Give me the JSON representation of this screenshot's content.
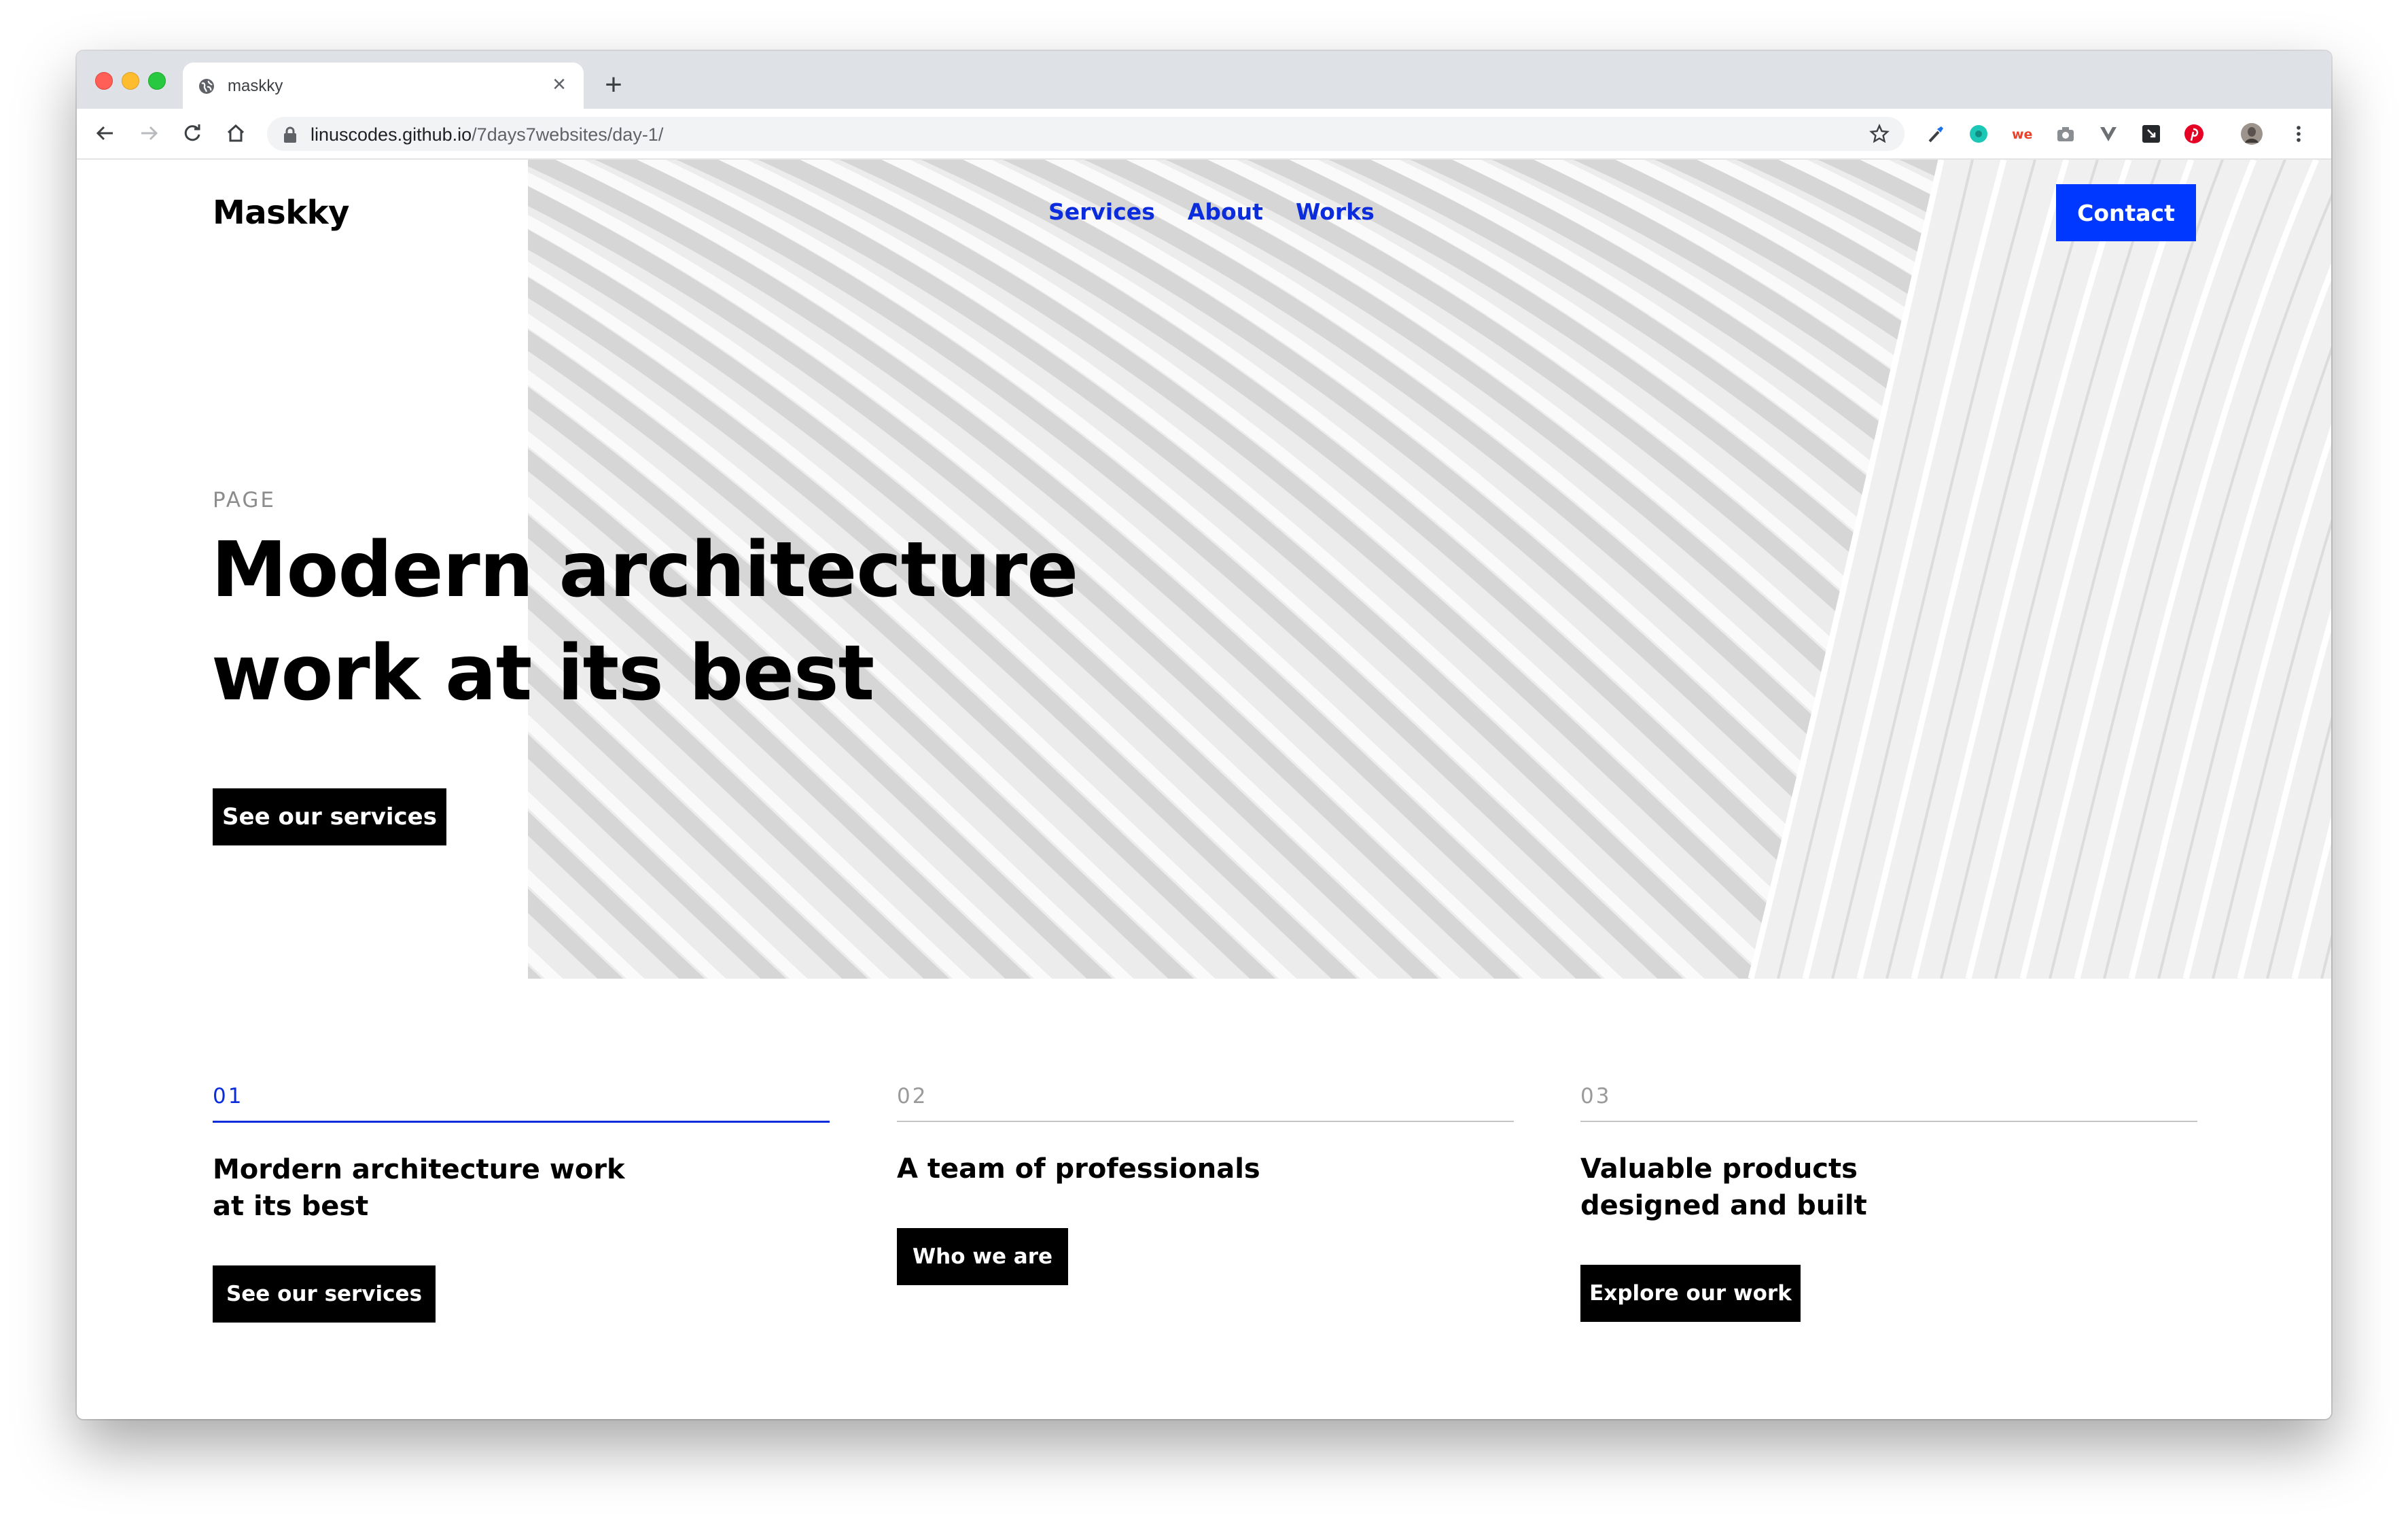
{
  "browser": {
    "tab_title": "maskky",
    "new_tab_label": "+",
    "close_label": "×",
    "url_host": "linuscodes.github.io",
    "url_path": "/7days7websites/day-1/"
  },
  "site": {
    "logo": "Maskky",
    "nav": [
      "Services",
      "About",
      "Works"
    ],
    "contact_label": "Contact",
    "accent_color": "#0038ff"
  },
  "hero": {
    "eyebrow": "PAGE",
    "title_line1": "Modern architecture",
    "title_line2": "work at its best",
    "cta": "See our services"
  },
  "features": [
    {
      "number": "01",
      "title": "Mordern architecture work at its best",
      "button": "See our services",
      "active": true
    },
    {
      "number": "02",
      "title": "A team of professionals",
      "button": "Who we are",
      "active": false
    },
    {
      "number": "03",
      "title": "Valuable products designed and built",
      "button": "Explore our work",
      "active": false
    }
  ],
  "icons": {
    "toolbar": [
      "back-arrow-icon",
      "forward-arrow-icon",
      "reload-icon",
      "home-icon",
      "lock-icon",
      "bookmark-star-icon"
    ],
    "extensions": [
      "eyedropper-icon",
      "teal-circle-extension-icon",
      "we-extension-icon",
      "camera-icon",
      "v-extension-icon",
      "dark-square-extension-icon",
      "pinterest-icon",
      "profile-avatar-icon",
      "menu-kebab-icon"
    ]
  }
}
